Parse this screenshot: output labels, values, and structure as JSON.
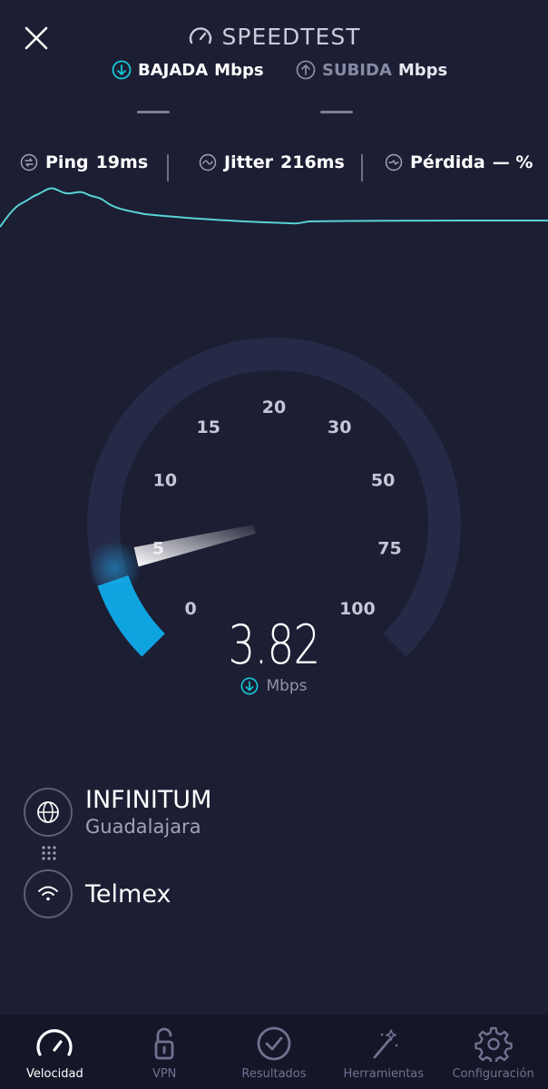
{
  "header": {
    "title": "SPEEDTEST"
  },
  "direction": {
    "download_label": "BAJADA",
    "download_unit": "Mbps",
    "upload_label": "SUBIDA",
    "upload_unit": "Mbps",
    "download_value": "—",
    "upload_value": "—"
  },
  "metrics": {
    "ping_label": "Ping",
    "ping_value": "19ms",
    "jitter_label": "Jitter",
    "jitter_value": "216ms",
    "loss_label": "Pérdida",
    "loss_value": "— %"
  },
  "gauge": {
    "tick_labels": [
      "0",
      "5",
      "10",
      "15",
      "20",
      "30",
      "50",
      "75",
      "100"
    ],
    "current_value": 3.82,
    "fill_color": "#0fa3e0",
    "track_color": "#252a47"
  },
  "speed": {
    "value": "3.82",
    "unit": "Mbps"
  },
  "provider": {
    "isp_name": "INFINITUM",
    "isp_location": "Guadalajara",
    "server_name": "Telmex"
  },
  "nav": {
    "items": [
      {
        "label": "Velocidad",
        "icon": "speedometer-icon",
        "active": true
      },
      {
        "label": "VPN",
        "icon": "padlock-icon",
        "active": false
      },
      {
        "label": "Resultados",
        "icon": "checkmark-circle-icon",
        "active": false
      },
      {
        "label": "Herramientas",
        "icon": "magic-wand-icon",
        "active": false
      },
      {
        "label": "Configuración",
        "icon": "gear-icon",
        "active": false
      }
    ]
  },
  "colors": {
    "accent": "#14c8d8",
    "background": "#1c1e33",
    "gauge_fill": "#0fa3e0"
  }
}
